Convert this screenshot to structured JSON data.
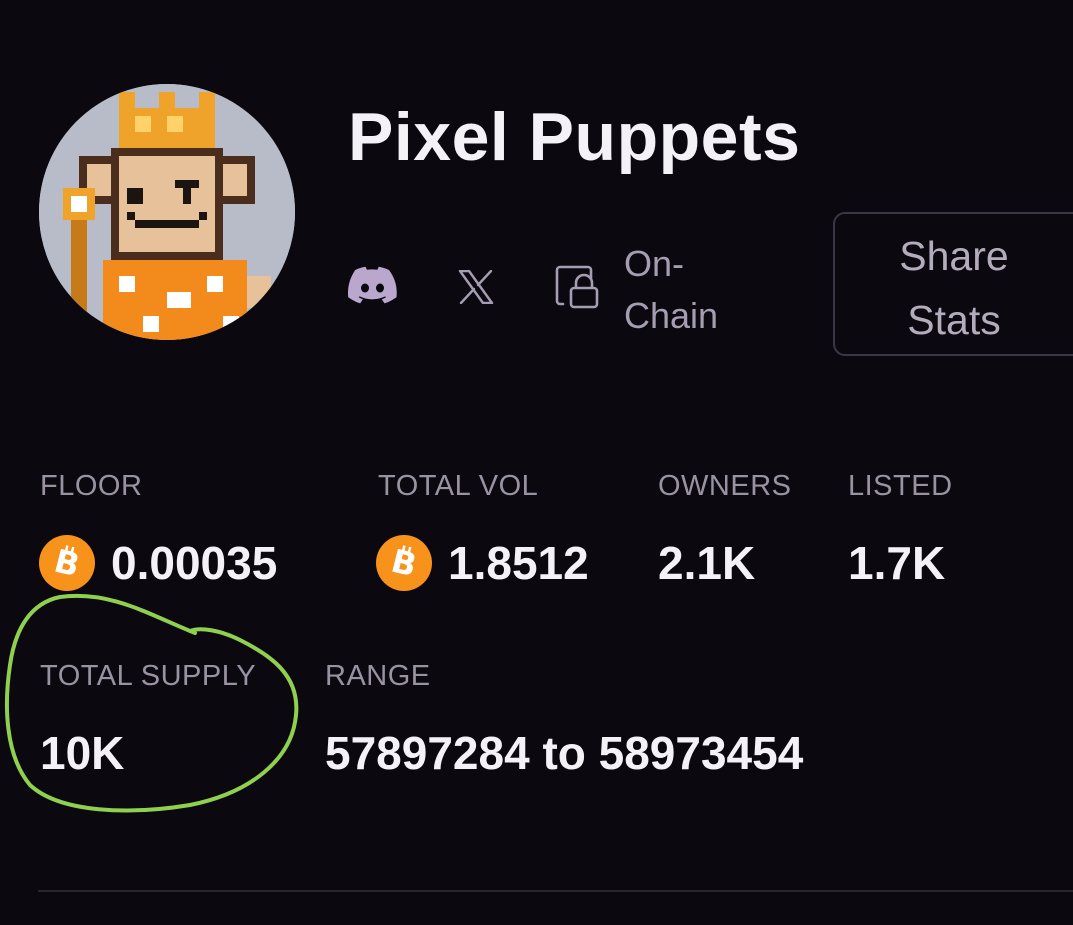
{
  "collection": {
    "name": "Pixel Puppets",
    "avatar_icon": "pixel-monkey-king-avatar"
  },
  "links": {
    "discord_icon": "discord-icon",
    "x_icon": "x-icon",
    "onchain_icon": "lock-document-icon",
    "onchain_label_line1": "On-",
    "onchain_label_line2": "Chain"
  },
  "share": {
    "label_line1": "Share",
    "label_line2": "Stats"
  },
  "stats": {
    "floor": {
      "label": "FLOOR",
      "value": "0.00035",
      "currency_icon": "bitcoin-icon"
    },
    "total_vol": {
      "label": "TOTAL VOL",
      "value": "1.8512",
      "currency_icon": "bitcoin-icon"
    },
    "owners": {
      "label": "OWNERS",
      "value": "2.1K"
    },
    "listed": {
      "label": "LISTED",
      "value": "1.7K"
    },
    "total_supply": {
      "label": "TOTAL SUPPLY",
      "value": "10K"
    },
    "range": {
      "label": "RANGE",
      "value": "57897284 to 58973454"
    }
  },
  "colors": {
    "background": "#0b080f",
    "bitcoin": "#f7931a",
    "annotation_circle": "#8fd14f",
    "muted_text": "#9a92a3"
  }
}
